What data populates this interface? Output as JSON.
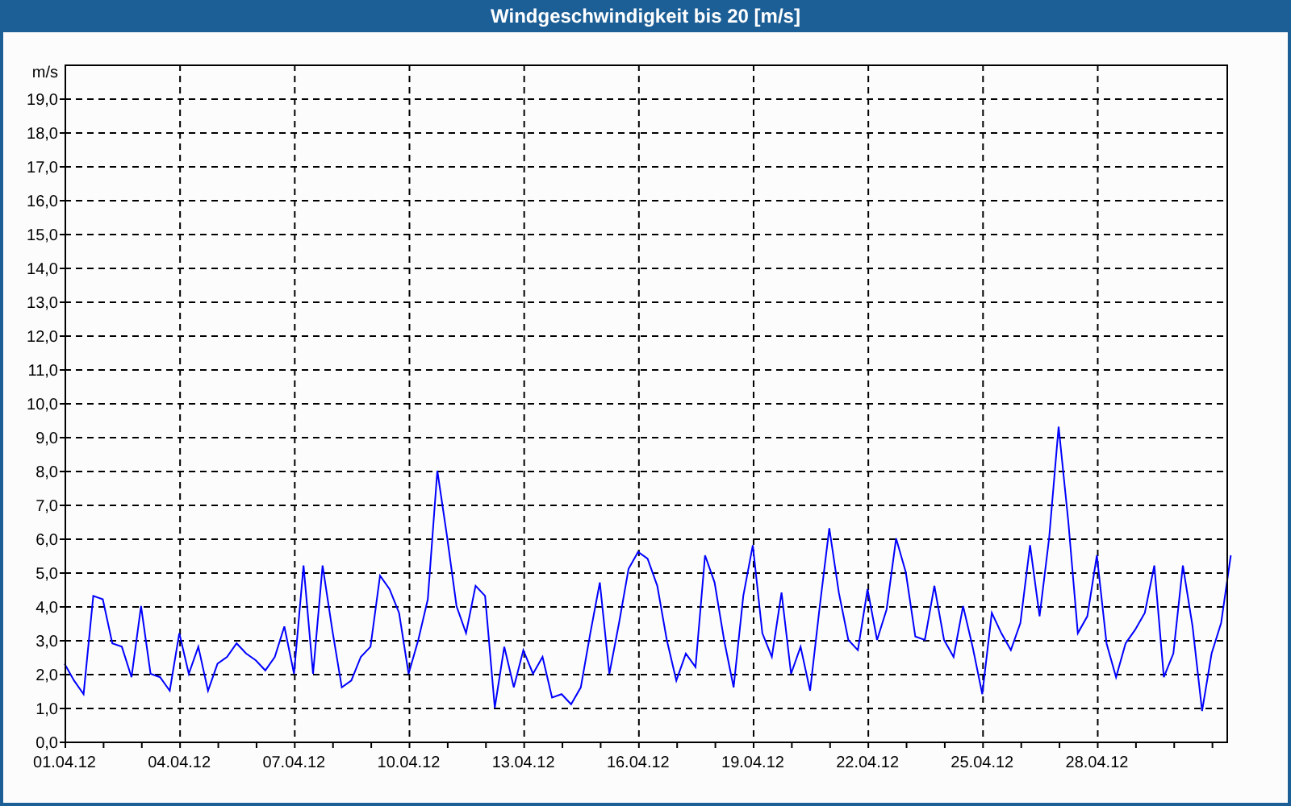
{
  "window": {
    "title": "Windgeschwindigkeit bis 20 [m/s]"
  },
  "chart": {
    "chart_data": {
      "type": "line",
      "grid": true,
      "ylabel": "m/s",
      "ylim": [
        0,
        20
      ],
      "categories": [
        "01.04.12",
        null,
        null,
        null,
        null,
        null,
        null,
        null,
        null,
        null,
        null,
        null,
        "04.04.12",
        null,
        null,
        null,
        null,
        null,
        null,
        null,
        null,
        null,
        null,
        null,
        "07.04.12",
        null,
        null,
        null,
        null,
        null,
        null,
        null,
        null,
        null,
        null,
        null,
        "10.04.12",
        null,
        null,
        null,
        null,
        null,
        null,
        null,
        null,
        null,
        null,
        null,
        "13.04.12",
        null,
        null,
        null,
        null,
        null,
        null,
        null,
        null,
        null,
        null,
        null,
        "16.04.12",
        null,
        null,
        null,
        null,
        null,
        null,
        null,
        null,
        null,
        null,
        null,
        "19.04.12",
        null,
        null,
        null,
        null,
        null,
        null,
        null,
        null,
        null,
        null,
        null,
        "22.04.12",
        null,
        null,
        null,
        null,
        null,
        null,
        null,
        null,
        null,
        null,
        null,
        "25.04.12",
        null,
        null,
        null,
        null,
        null,
        null,
        null,
        null,
        null,
        null,
        null,
        "28.04.12",
        null,
        null,
        null,
        null,
        null,
        null,
        null,
        null,
        null,
        null,
        null,
        null,
        null,
        null
      ],
      "yticks": [
        {
          "value": 0,
          "label": "0,0"
        },
        {
          "value": 1,
          "label": "1,0"
        },
        {
          "value": 2,
          "label": "2,0"
        },
        {
          "value": 3,
          "label": "3,0"
        },
        {
          "value": 4,
          "label": "4,0"
        },
        {
          "value": 5,
          "label": "5,0"
        },
        {
          "value": 6,
          "label": "6,0"
        },
        {
          "value": 7,
          "label": "7,0"
        },
        {
          "value": 8,
          "label": "8,0"
        },
        {
          "value": 9,
          "label": "9,0"
        },
        {
          "value": 10,
          "label": "10,0"
        },
        {
          "value": 11,
          "label": "11,0"
        },
        {
          "value": 12,
          "label": "12,0"
        },
        {
          "value": 13,
          "label": "13,0"
        },
        {
          "value": 14,
          "label": "14,0"
        },
        {
          "value": 15,
          "label": "15,0"
        },
        {
          "value": 16,
          "label": "16,0"
        },
        {
          "value": 17,
          "label": "17,0"
        },
        {
          "value": 18,
          "label": "18,0"
        },
        {
          "value": 19,
          "label": "19,0"
        }
      ],
      "series": [
        {
          "color": "#0000ff",
          "values": [
            2.3,
            1.8,
            1.4,
            4.3,
            4.2,
            2.9,
            2.8,
            1.9,
            4.0,
            2.0,
            1.9,
            1.5,
            3.2,
            2.0,
            2.8,
            1.5,
            2.3,
            2.5,
            2.9,
            2.6,
            2.4,
            2.1,
            2.5,
            3.4,
            2.0,
            5.2,
            2.0,
            5.2,
            3.3,
            1.6,
            1.8,
            2.5,
            2.8,
            4.9,
            4.5,
            3.8,
            2.0,
            3.0,
            4.2,
            8.0,
            6.1,
            4.0,
            3.2,
            4.6,
            4.3,
            1.0,
            2.8,
            1.6,
            2.7,
            2.0,
            2.5,
            1.3,
            1.4,
            1.1,
            1.6,
            3.2,
            4.7,
            2.0,
            3.5,
            5.1,
            5.6,
            5.4,
            4.6,
            3.0,
            1.8,
            2.6,
            2.2,
            5.5,
            4.7,
            3.0,
            1.6,
            4.3,
            5.8,
            3.2,
            2.5,
            4.4,
            2.0,
            2.8,
            1.5,
            4.0,
            6.3,
            4.4,
            3.0,
            2.7,
            4.5,
            3.0,
            3.9,
            6.0,
            5.0,
            3.1,
            3.0,
            4.6,
            3.0,
            2.5,
            4.0,
            2.8,
            1.4,
            3.8,
            3.2,
            2.7,
            3.5,
            5.8,
            3.7,
            6.0,
            9.3,
            6.5,
            3.2,
            3.7,
            5.5,
            2.9,
            1.9,
            2.9,
            3.3,
            3.8,
            5.2,
            1.9,
            2.6,
            5.2,
            3.4,
            0.9,
            2.6,
            3.5,
            5.5
          ]
        }
      ]
    }
  }
}
